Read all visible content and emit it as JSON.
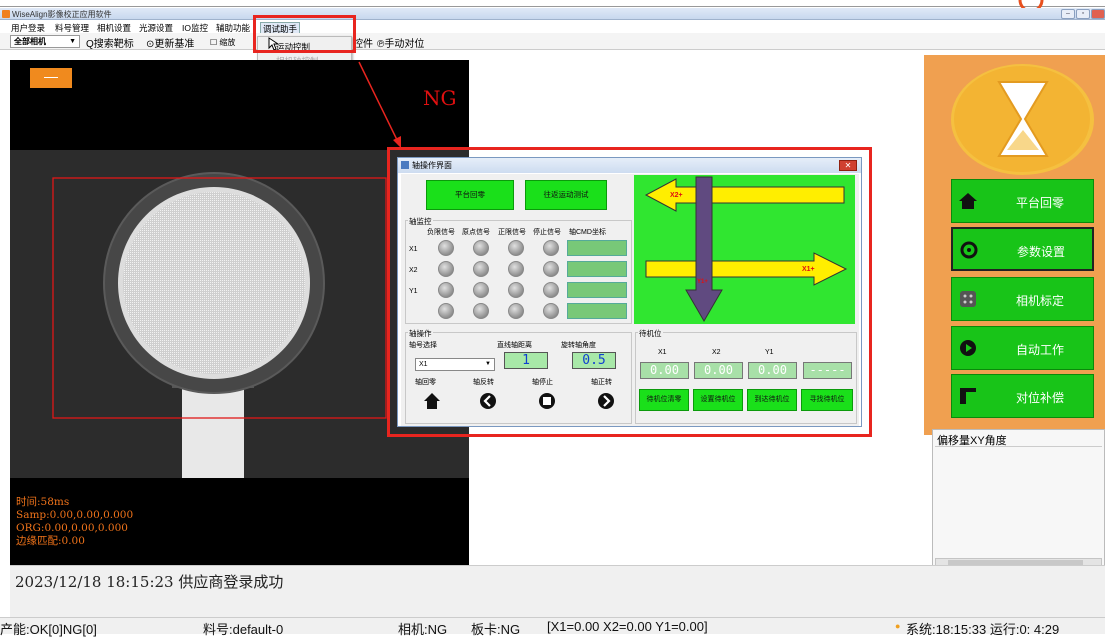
{
  "window": {
    "title": "WiseAlign影像校正应用软件"
  },
  "menu": {
    "items": [
      "用户登录",
      "料号管理",
      "相机设置",
      "光源设置",
      "IO监控",
      "辅助功能",
      "调试助手"
    ]
  },
  "dropdown": {
    "items": [
      "运动控制",
      "相机轴控制"
    ]
  },
  "toolbar": {
    "camera_select": "全部相机",
    "search_target": "Q搜索靶标",
    "update_base": "⊙更新基准",
    "shrink": "缩放",
    "controls": "控件",
    "manual_align": "℗手动对位"
  },
  "camera": {
    "result": "NG",
    "info": "时间:58ms\nSamp:0.00,0.00,0.000\nORG:0.00,0.00,0.000\n边缘匹配:0.00"
  },
  "dialog": {
    "title": "轴操作界面",
    "close": "✕",
    "btn_home": "平台回零",
    "btn_move_test": "往返运动测试",
    "monitor_label": "轴监控",
    "monitor_cols": [
      "负限信号",
      "原点信号",
      "正限信号",
      "停止信号",
      "轴CMD坐标"
    ],
    "monitor_rows": [
      "X1",
      "X2",
      "Y1"
    ],
    "operation_label": "轴操作",
    "axis_select_label": "轴号选择",
    "line_distance_label": "直线轴距离",
    "rotate_angle_label": "旋转轴角度",
    "axis_selected": "X1",
    "line_distance": "1",
    "rotate_angle": "0.5",
    "axis_home": "轴回零",
    "axis_reverse": "轴反转",
    "axis_stop": "轴停止",
    "axis_forward": "轴正转",
    "standby_label": "待机位",
    "standby_cols": [
      "X1",
      "X2",
      "Y1"
    ],
    "standby_values": [
      "0.00",
      "0.00",
      "0.00",
      "-----"
    ],
    "standby_buttons": [
      "待机位清零",
      "设置待机位",
      "到达待机位",
      "寻找待机位"
    ],
    "diagram_x2": "X2+",
    "diagram_x1": "X1+",
    "diagram_y1": "Y1+"
  },
  "sidebar": {
    "buttons": [
      "平台回零",
      "参数设置",
      "相机标定",
      "自动工作",
      "对位补偿"
    ]
  },
  "offset": {
    "header": "偏移量XY角度"
  },
  "log": {
    "message": "2023/12/18  18:15:23  供应商登录成功"
  },
  "status": {
    "production": "产能:OK[0]NG[0]",
    "part": "料号:default-0",
    "camera": "相机:NG",
    "board": "板卡:NG",
    "coords": "[X1=0.00 X2=0.00 Y1=0.00]",
    "system": "系统:18:15:33  运行:0: 4:29"
  },
  "colors": {
    "accent_green": "#1ae01a",
    "orange": "#f0a050",
    "highlight_red": "#e8251f"
  }
}
